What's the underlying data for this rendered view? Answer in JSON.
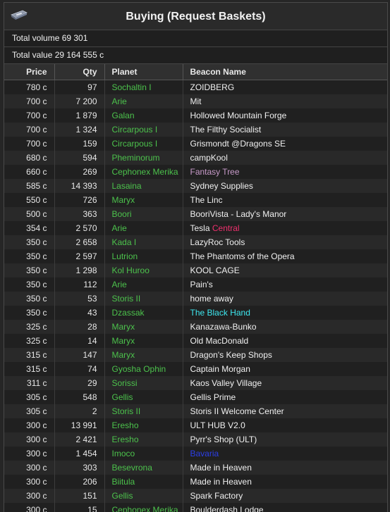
{
  "window": {
    "title": "Buying (Request Baskets)",
    "icon": "basket-icon"
  },
  "summary": {
    "volume_label": "Total volume 69 301",
    "value_label": "Total value 29 164 555 c"
  },
  "columns": [
    "Price",
    "Qty",
    "Planet",
    "Beacon Name"
  ],
  "colors": {
    "planet": "#4cc24c",
    "beacon_default": "#f0f0f0"
  },
  "rows": [
    {
      "price": "780 c",
      "qty": "97",
      "planet": "Sochaltin I",
      "beacon": [
        {
          "t": "ZOIDBERG"
        }
      ]
    },
    {
      "price": "700 c",
      "qty": "7 200",
      "planet": "Arie",
      "beacon": [
        {
          "t": "Mit"
        }
      ]
    },
    {
      "price": "700 c",
      "qty": "1 879",
      "planet": "Galan",
      "beacon": [
        {
          "t": "Hollowed Mountain Forge"
        }
      ]
    },
    {
      "price": "700 c",
      "qty": "1 324",
      "planet": "Circarpous I",
      "beacon": [
        {
          "t": "The Filthy Socialist"
        }
      ]
    },
    {
      "price": "700 c",
      "qty": "159",
      "planet": "Circarpous I",
      "beacon": [
        {
          "t": "Grismondt @Dragons SE"
        }
      ]
    },
    {
      "price": "680 c",
      "qty": "594",
      "planet": "Pheminorum",
      "beacon": [
        {
          "t": "campKool"
        }
      ]
    },
    {
      "price": "660 c",
      "qty": "269",
      "planet": "Cephonex Merika",
      "beacon": [
        {
          "t": "Fantasy Tree",
          "c": "#c79ac9"
        }
      ]
    },
    {
      "price": "585 c",
      "qty": "14 393",
      "planet": "Lasaina",
      "beacon": [
        {
          "t": "Sydney Supplies"
        }
      ]
    },
    {
      "price": "550 c",
      "qty": "726",
      "planet": "Maryx",
      "beacon": [
        {
          "t": "The Linc"
        }
      ]
    },
    {
      "price": "500 c",
      "qty": "363",
      "planet": "Boori",
      "beacon": [
        {
          "t": "BooriVista - Lady's Manor"
        }
      ]
    },
    {
      "price": "354 c",
      "qty": "2 570",
      "planet": "Arie",
      "beacon": [
        {
          "t": "Tesla "
        },
        {
          "t": "Central",
          "c": "#f0306e"
        }
      ]
    },
    {
      "price": "350 c",
      "qty": "2 658",
      "planet": "Kada I",
      "beacon": [
        {
          "t": "LazyRoc Tools"
        }
      ]
    },
    {
      "price": "350 c",
      "qty": "2 597",
      "planet": "Lutrion",
      "beacon": [
        {
          "t": "The Phantoms of the Opera"
        }
      ]
    },
    {
      "price": "350 c",
      "qty": "1 298",
      "planet": "Kol Huroo",
      "beacon": [
        {
          "t": "KOOL CAGE"
        }
      ]
    },
    {
      "price": "350 c",
      "qty": "112",
      "planet": "Arie",
      "beacon": [
        {
          "t": "Pain's"
        }
      ]
    },
    {
      "price": "350 c",
      "qty": "53",
      "planet": "Storis II",
      "beacon": [
        {
          "t": "home away"
        }
      ]
    },
    {
      "price": "350 c",
      "qty": "43",
      "planet": "Dzassak",
      "beacon": [
        {
          "t": "The Black Hand",
          "c": "#3ee6ee"
        }
      ]
    },
    {
      "price": "325 c",
      "qty": "28",
      "planet": "Maryx",
      "beacon": [
        {
          "t": "Kanazawa-Bunko"
        }
      ]
    },
    {
      "price": "325 c",
      "qty": "14",
      "planet": "Maryx",
      "beacon": [
        {
          "t": "Old MacDonald"
        }
      ]
    },
    {
      "price": "315 c",
      "qty": "147",
      "planet": "Maryx",
      "beacon": [
        {
          "t": "Dragon's Keep Shops"
        }
      ]
    },
    {
      "price": "315 c",
      "qty": "74",
      "planet": "Gyosha Ophin",
      "beacon": [
        {
          "t": "Captain Morgan"
        }
      ]
    },
    {
      "price": "311 c",
      "qty": "29",
      "planet": "Sorissi",
      "beacon": [
        {
          "t": "Kaos Valley Village"
        }
      ]
    },
    {
      "price": "305 c",
      "qty": "548",
      "planet": "Gellis",
      "beacon": [
        {
          "t": "Gellis Prime"
        }
      ]
    },
    {
      "price": "305 c",
      "qty": "2",
      "planet": "Storis II",
      "beacon": [
        {
          "t": "Storis II Welcome Center"
        }
      ]
    },
    {
      "price": "300 c",
      "qty": "13 991",
      "planet": "Eresho",
      "beacon": [
        {
          "t": "ULT HUB V2.0"
        }
      ]
    },
    {
      "price": "300 c",
      "qty": "2 421",
      "planet": "Eresho",
      "beacon": [
        {
          "t": "Pyrr's Shop (ULT)"
        }
      ]
    },
    {
      "price": "300 c",
      "qty": "1 454",
      "planet": "Imoco",
      "beacon": [
        {
          "t": "Bavaria",
          "c": "#2b3ee8"
        }
      ]
    },
    {
      "price": "300 c",
      "qty": "303",
      "planet": "Besevrona",
      "beacon": [
        {
          "t": "Made in Heaven"
        }
      ]
    },
    {
      "price": "300 c",
      "qty": "206",
      "planet": "Biitula",
      "beacon": [
        {
          "t": "Made in Heaven"
        }
      ]
    },
    {
      "price": "300 c",
      "qty": "151",
      "planet": "Gellis",
      "beacon": [
        {
          "t": "Spark Factory"
        }
      ]
    },
    {
      "price": "300 c",
      "qty": "15",
      "planet": "Cephonex Merika",
      "beacon": [
        {
          "t": "Boulderdash Lodge"
        }
      ]
    }
  ]
}
